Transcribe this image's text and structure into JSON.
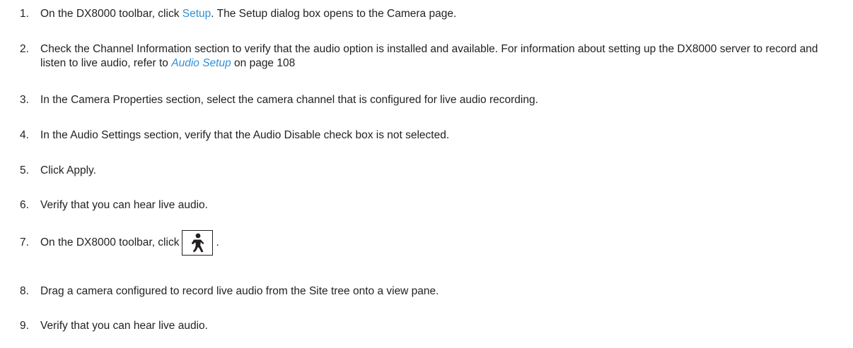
{
  "steps": [
    {
      "number": "1.",
      "before": "On the DX8000 toolbar, click ",
      "link": "Setup",
      "after": ". The Setup dialog box opens to the Camera page."
    },
    {
      "number": "2.",
      "before": "Check the Channel Information section to verify that the audio option is installed and available. For information about setting up the DX8000 server to record and listen to live audio, refer to ",
      "link": "Audio Setup",
      "after": " on page 108"
    },
    {
      "number": "3.",
      "text": "In the Camera Properties section, select the camera channel that is configured for live audio recording."
    },
    {
      "number": "4.",
      "text": "In the Audio Settings section, verify that the Audio Disable check box is not selected."
    },
    {
      "number": "5.",
      "text": "Click Apply."
    },
    {
      "number": "6.",
      "text": "Verify that you can hear live audio."
    },
    {
      "number": "7.",
      "before": "On the DX8000 toolbar, click",
      "after": ".",
      "icon": "live-view-walking-person-icon"
    },
    {
      "number": "8.",
      "text": "Drag a camera configured to record live audio from the Site tree onto a view pane."
    },
    {
      "number": "9.",
      "text": "Verify that you can hear live audio."
    }
  ],
  "colors": {
    "text": "#231f20",
    "link": "#2e8fd6"
  }
}
